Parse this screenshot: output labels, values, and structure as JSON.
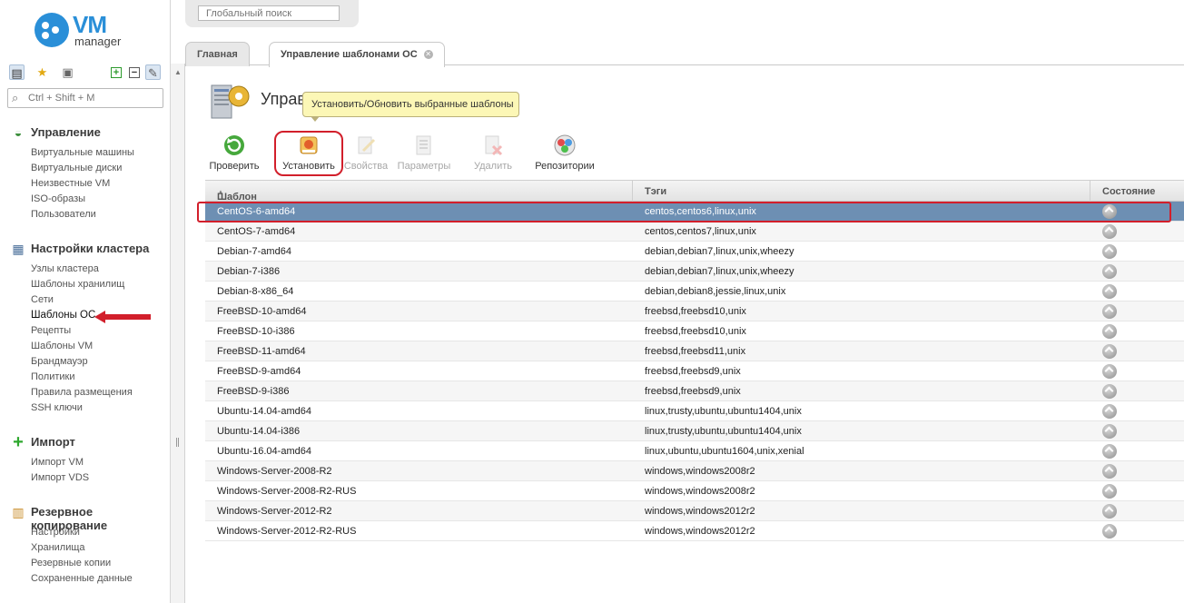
{
  "app": {
    "logo_text": "VM",
    "logo_subtext": "manager"
  },
  "top": {
    "global_search_placeholder": "Глобальный поиск"
  },
  "sidebar": {
    "search_placeholder": "Ctrl + Shift + M",
    "groups": [
      {
        "title": "Управление",
        "items": [
          "Виртуальные машины",
          "Виртуальные диски",
          "Неизвестные VM",
          "ISO-образы",
          "Пользователи"
        ]
      },
      {
        "title": "Настройки кластера",
        "items": [
          "Узлы кластера",
          "Шаблоны хранилищ",
          "Сети",
          "Шаблоны ОС",
          "Рецепты",
          "Шаблоны VM",
          "Брандмауэр",
          "Политики",
          "Правила размещения",
          "SSH ключи"
        ]
      },
      {
        "title": "Импорт",
        "items": [
          "Импорт VM",
          "Импорт VDS"
        ]
      },
      {
        "title": "Резервное копирование",
        "items": [
          "Настройки",
          "Хранилища",
          "Резервные копии",
          "Сохраненные данные"
        ]
      }
    ]
  },
  "tabs": [
    {
      "label": "Главная"
    },
    {
      "label": "Управление шаблонами ОС"
    }
  ],
  "page": {
    "title": "Управ"
  },
  "tooltip": "Установить/Обновить выбранные шаблоны",
  "toolbar": [
    {
      "label": "Проверить",
      "icon": "refresh-icon",
      "enabled": true
    },
    {
      "label": "Установить",
      "icon": "install-icon",
      "enabled": true
    },
    {
      "label": "Свойства",
      "icon": "edit-icon",
      "enabled": false
    },
    {
      "label": "Параметры",
      "icon": "params-icon",
      "enabled": false
    },
    {
      "label": "Удалить",
      "icon": "delete-icon",
      "enabled": false
    },
    {
      "label": "Репозитории",
      "icon": "repo-icon",
      "enabled": true
    }
  ],
  "table": {
    "columns": [
      "Шаблон",
      "Тэги",
      "Состояние"
    ],
    "rows": [
      {
        "name": "CentOS-6-amd64",
        "tags": "centos,centos6,linux,unix",
        "selected": true
      },
      {
        "name": "CentOS-7-amd64",
        "tags": "centos,centos7,linux,unix"
      },
      {
        "name": "Debian-7-amd64",
        "tags": "debian,debian7,linux,unix,wheezy"
      },
      {
        "name": "Debian-7-i386",
        "tags": "debian,debian7,linux,unix,wheezy"
      },
      {
        "name": "Debian-8-x86_64",
        "tags": "debian,debian8,jessie,linux,unix"
      },
      {
        "name": "FreeBSD-10-amd64",
        "tags": "freebsd,freebsd10,unix"
      },
      {
        "name": "FreeBSD-10-i386",
        "tags": "freebsd,freebsd10,unix"
      },
      {
        "name": "FreeBSD-11-amd64",
        "tags": "freebsd,freebsd11,unix"
      },
      {
        "name": "FreeBSD-9-amd64",
        "tags": "freebsd,freebsd9,unix"
      },
      {
        "name": "FreeBSD-9-i386",
        "tags": "freebsd,freebsd9,unix"
      },
      {
        "name": "Ubuntu-14.04-amd64",
        "tags": "linux,trusty,ubuntu,ubuntu1404,unix"
      },
      {
        "name": "Ubuntu-14.04-i386",
        "tags": "linux,trusty,ubuntu,ubuntu1404,unix"
      },
      {
        "name": "Ubuntu-16.04-amd64",
        "tags": "linux,ubuntu,ubuntu1604,unix,xenial"
      },
      {
        "name": "Windows-Server-2008-R2",
        "tags": "windows,windows2008r2"
      },
      {
        "name": "Windows-Server-2008-R2-RUS",
        "tags": "windows,windows2008r2"
      },
      {
        "name": "Windows-Server-2012-R2",
        "tags": "windows,windows2012r2"
      },
      {
        "name": "Windows-Server-2012-R2-RUS",
        "tags": "windows,windows2012r2"
      }
    ]
  },
  "colors": {
    "accent": "#2a8fd8",
    "selected_row": "#6d8fb3",
    "highlight": "#d21f2b",
    "tooltip_bg": "#fcf7b6"
  }
}
